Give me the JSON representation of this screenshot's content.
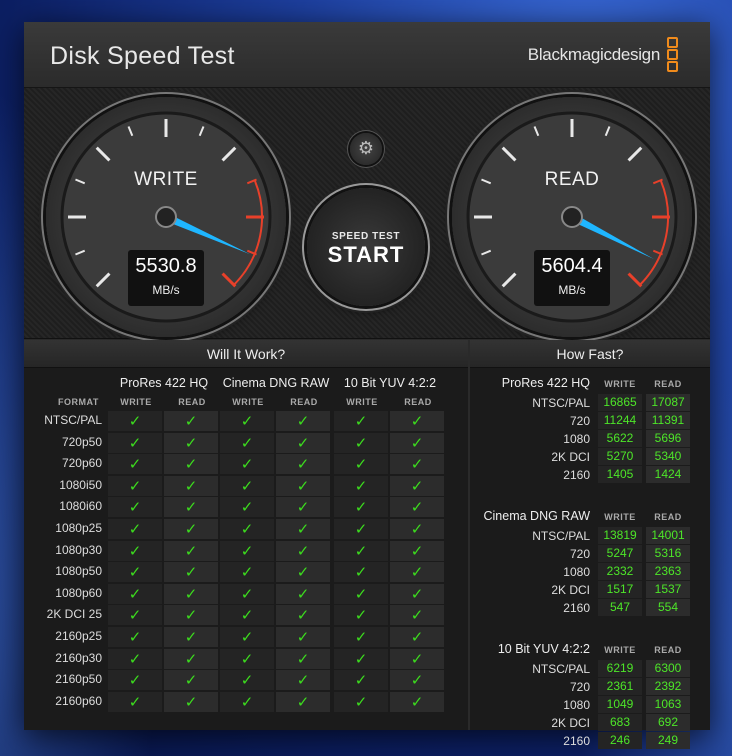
{
  "app": {
    "title": "Disk Speed Test",
    "brand": "Blackmagicdesign",
    "close_glyph": "✕"
  },
  "gauges": {
    "write": {
      "label": "WRITE",
      "value": "5530.8",
      "unit": "MB/s"
    },
    "read": {
      "label": "READ",
      "value": "5604.4",
      "unit": "MB/s"
    }
  },
  "controls": {
    "settings_icon": "gear-icon",
    "gear_glyph": "⚙",
    "start_small": "SPEED TEST",
    "start_big": "START"
  },
  "will_it_work": {
    "title": "Will It Work?",
    "format_header": "FORMAT",
    "codecs": [
      "ProRes 422 HQ",
      "Cinema DNG RAW",
      "10 Bit YUV 4:2:2"
    ],
    "sub_headers": [
      "WRITE",
      "READ"
    ],
    "check_glyph": "✓",
    "formats": [
      "NTSC/PAL",
      "720p50",
      "720p60",
      "1080i50",
      "1080i60",
      "1080p25",
      "1080p30",
      "1080p50",
      "1080p60",
      "2K DCI 25",
      "2160p25",
      "2160p30",
      "2160p50",
      "2160p60"
    ]
  },
  "how_fast": {
    "title": "How Fast?",
    "sub_headers": [
      "WRITE",
      "READ"
    ],
    "groups": [
      {
        "name": "ProRes 422 HQ",
        "rows": [
          {
            "label": "NTSC/PAL",
            "write": "16865",
            "read": "17087"
          },
          {
            "label": "720",
            "write": "11244",
            "read": "11391"
          },
          {
            "label": "1080",
            "write": "5622",
            "read": "5696"
          },
          {
            "label": "2K DCI",
            "write": "5270",
            "read": "5340"
          },
          {
            "label": "2160",
            "write": "1405",
            "read": "1424"
          }
        ]
      },
      {
        "name": "Cinema DNG RAW",
        "rows": [
          {
            "label": "NTSC/PAL",
            "write": "13819",
            "read": "14001"
          },
          {
            "label": "720",
            "write": "5247",
            "read": "5316"
          },
          {
            "label": "1080",
            "write": "2332",
            "read": "2363"
          },
          {
            "label": "2K DCI",
            "write": "1517",
            "read": "1537"
          },
          {
            "label": "2160",
            "write": "547",
            "read": "554"
          }
        ]
      },
      {
        "name": "10 Bit YUV 4:2:2",
        "rows": [
          {
            "label": "NTSC/PAL",
            "write": "6219",
            "read": "6300"
          },
          {
            "label": "720",
            "write": "2361",
            "read": "2392"
          },
          {
            "label": "1080",
            "write": "1049",
            "read": "1063"
          },
          {
            "label": "2K DCI",
            "write": "683",
            "read": "692"
          },
          {
            "label": "2160",
            "write": "246",
            "read": "249"
          }
        ]
      }
    ]
  }
}
